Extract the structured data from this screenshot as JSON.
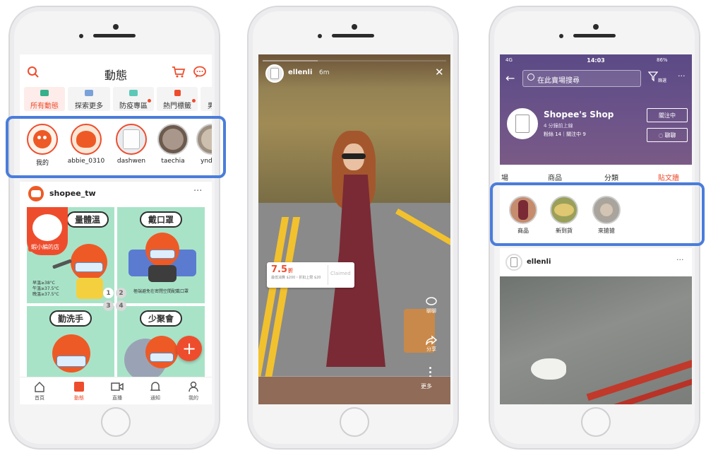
{
  "colors": {
    "accent": "#ee4d2d",
    "highlight": "#4a7ddb",
    "tile": "#a8e3c8",
    "shop_header": "#6d5489"
  },
  "phone1": {
    "title": "動態",
    "tabs": [
      {
        "label": "所有動態",
        "active": true
      },
      {
        "label": "探索更多"
      },
      {
        "label": "防疫專區"
      },
      {
        "label": "熱門標籤"
      },
      {
        "label": "男仕"
      }
    ],
    "stories": [
      {
        "name": "我的"
      },
      {
        "name": "abbie_0310"
      },
      {
        "name": "dashwen"
      },
      {
        "name": "taechia"
      },
      {
        "name": "yndi"
      }
    ],
    "post_user": "shopee_tw",
    "more_icon": "···",
    "shop_badge": "蝦小編的店",
    "tiles": [
      "量體溫",
      "戴口罩",
      "勤洗手",
      "少聚會"
    ],
    "tile1_notes": [
      "早溫≥38°C",
      "午溫≥37.5°C",
      "晚溫≥37.5°C"
    ],
    "tile2_note": "極端避免在密閉空間配戴口罩",
    "pager": [
      "1",
      "2",
      "3",
      "4"
    ],
    "fab": "+",
    "nav": [
      {
        "label": "首頁",
        "icon": "home-icon"
      },
      {
        "label": "動態",
        "icon": "feed-icon",
        "active": true
      },
      {
        "label": "直播",
        "icon": "live-icon"
      },
      {
        "label": "通知",
        "icon": "bell-icon"
      },
      {
        "label": "我的",
        "icon": "person-icon"
      }
    ]
  },
  "phone2": {
    "user": "ellenli",
    "time": "6m",
    "close": "✕",
    "price": "7.5",
    "price_unit": "折",
    "coupon_note": "最低消費 $200・折扣上限 $20",
    "coupon_btn": "Claimed",
    "actions": [
      {
        "label": "聊聊",
        "icon": "chat-icon"
      },
      {
        "label": "分享",
        "icon": "share-icon"
      }
    ],
    "more": "更多"
  },
  "phone3": {
    "status": {
      "carrier": "4G",
      "time": "14:03",
      "battery": "86%"
    },
    "search_placeholder": "在此賣場搜尋",
    "filter": "篩選",
    "shop_name": "Shopee's Shop",
    "shop_online": "4 分鐘前上線",
    "shop_stats": "粉絲 14｜關注中 9",
    "follow": "關注中",
    "chat": "聊聊",
    "tabs": [
      {
        "label": "場"
      },
      {
        "label": "商品"
      },
      {
        "label": "分類"
      },
      {
        "label": "貼文牆",
        "active": true
      }
    ],
    "highlights": [
      {
        "name": "商品"
      },
      {
        "name": "新到貨"
      },
      {
        "name": "來搶搶"
      }
    ],
    "post_user": "ellenli",
    "more_icon": "···"
  }
}
